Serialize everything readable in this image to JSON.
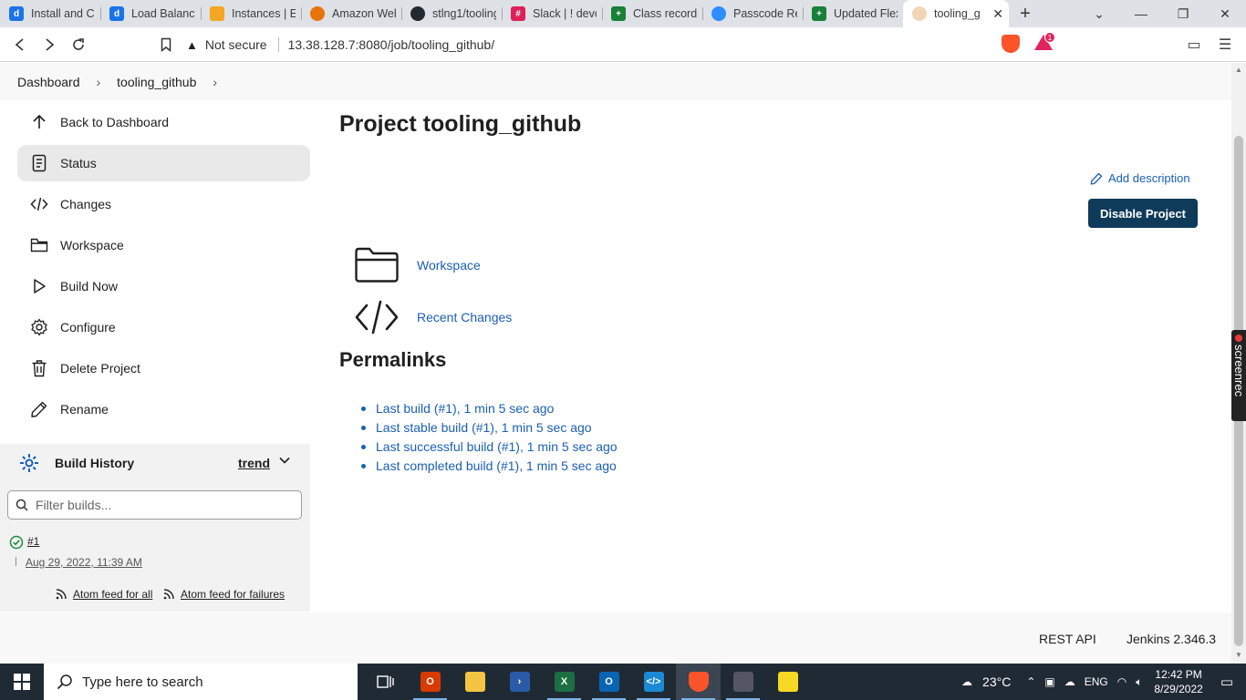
{
  "browser": {
    "tabs": [
      {
        "title": "Install and Co",
        "icon": "google-docs-icon",
        "color": "#1a73e8"
      },
      {
        "title": "Load Balancer",
        "icon": "google-docs-icon",
        "color": "#1a73e8"
      },
      {
        "title": "Instances | EC",
        "icon": "aws-cube-icon",
        "color": "#f5a623"
      },
      {
        "title": "Amazon Web",
        "icon": "aws-hexagon-icon",
        "color": "#e8730c"
      },
      {
        "title": "stlng1/tooling",
        "icon": "github-icon",
        "color": "#24292f"
      },
      {
        "title": "Slack | ! devo",
        "icon": "slack-icon",
        "color": "#e01e5a"
      },
      {
        "title": "Class recording",
        "icon": "google-sheets-icon",
        "color": "#188038"
      },
      {
        "title": "Passcode Req",
        "icon": "zoom-icon",
        "color": "#2d8cff"
      },
      {
        "title": "Updated Flex",
        "icon": "google-sheets-icon",
        "color": "#188038"
      },
      {
        "title": "tooling_g",
        "icon": "jenkins-icon",
        "color": "#d33833",
        "active": true
      }
    ],
    "address": {
      "security": "Not secure",
      "url": "13.38.128.7:8080/job/tooling_github/"
    },
    "rewards_badge": "1"
  },
  "breadcrumb": {
    "items": [
      "Dashboard",
      "tooling_github"
    ]
  },
  "sidebar": {
    "items": [
      {
        "label": "Back to Dashboard",
        "icon": "arrow-up-icon"
      },
      {
        "label": "Status",
        "icon": "document-icon",
        "active": true
      },
      {
        "label": "Changes",
        "icon": "code-icon"
      },
      {
        "label": "Workspace",
        "icon": "folder-icon"
      },
      {
        "label": "Build Now",
        "icon": "play-icon"
      },
      {
        "label": "Configure",
        "icon": "gear-icon"
      },
      {
        "label": "Delete Project",
        "icon": "trash-icon"
      },
      {
        "label": "Rename",
        "icon": "pencil-icon"
      }
    ],
    "build_history": {
      "title": "Build History",
      "trend": "trend",
      "filter_placeholder": "Filter builds...",
      "builds": [
        {
          "number": "#1",
          "date": "Aug 29, 2022, 11:39 AM",
          "status": "success"
        }
      ],
      "feed_all": "Atom feed for all",
      "feed_failures": "Atom feed for failures"
    }
  },
  "main": {
    "title": "Project tooling_github",
    "add_description": "Add description",
    "disable_button": "Disable Project",
    "links": [
      {
        "label": "Workspace",
        "icon": "folder-icon"
      },
      {
        "label": "Recent Changes",
        "icon": "code-icon"
      }
    ],
    "permalinks_title": "Permalinks",
    "permalinks": [
      "Last build (#1), 1 min 5 sec ago",
      "Last stable build (#1), 1 min 5 sec ago",
      "Last successful build (#1), 1 min 5 sec ago",
      "Last completed build (#1), 1 min 5 sec ago"
    ]
  },
  "footer": {
    "rest_api": "REST API",
    "version": "Jenkins 2.346.3"
  },
  "overlay": {
    "screenrec": "screenrec"
  },
  "taskbar": {
    "search_placeholder": "Type here to search",
    "temperature": "23°C",
    "time": "12:42 PM",
    "date": "8/29/2022",
    "lang": "ENG"
  }
}
